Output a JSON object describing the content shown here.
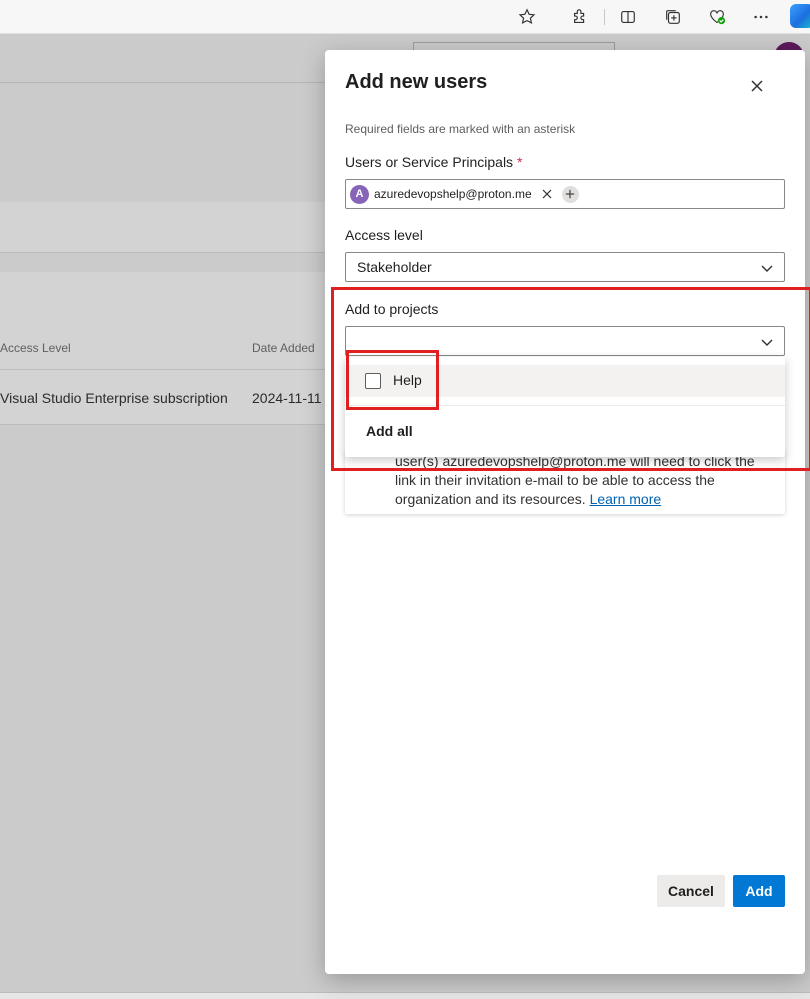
{
  "browser": {
    "icons": [
      "star-icon",
      "extension-icon",
      "split-screen-icon",
      "collections-icon",
      "browser-essentials-icon",
      "more-icon",
      "copilot-icon"
    ]
  },
  "background": {
    "columns": {
      "access_level": "Access Level",
      "date_added": "Date Added"
    },
    "row": {
      "access_level": "Visual Studio Enterprise subscription",
      "date_added": "2024-11-11"
    }
  },
  "panel": {
    "title": "Add new users",
    "required_note": "Required fields are marked with an asterisk",
    "users_label": "Users or Service Principals",
    "required_mark": "*",
    "user_chip": {
      "initial": "A",
      "email": "azuredevopshelp@proton.me"
    },
    "access_level_label": "Access level",
    "access_level_value": "Stakeholder",
    "projects_label": "Add to projects",
    "projects_value": "",
    "projects_options": [
      {
        "label": "Help",
        "checked": false
      }
    ],
    "add_all_label": "Add all",
    "info_text_partial": "user(s) azuredevopshelp@proton.me will need to click the link in their invitation e-mail to be able to access the organization and its resources.",
    "learn_more": "Learn more",
    "cancel_label": "Cancel",
    "add_label": "Add"
  },
  "colors": {
    "accent": "#0078d4",
    "annotation": "#e02020",
    "avatar": "#8764b8"
  }
}
